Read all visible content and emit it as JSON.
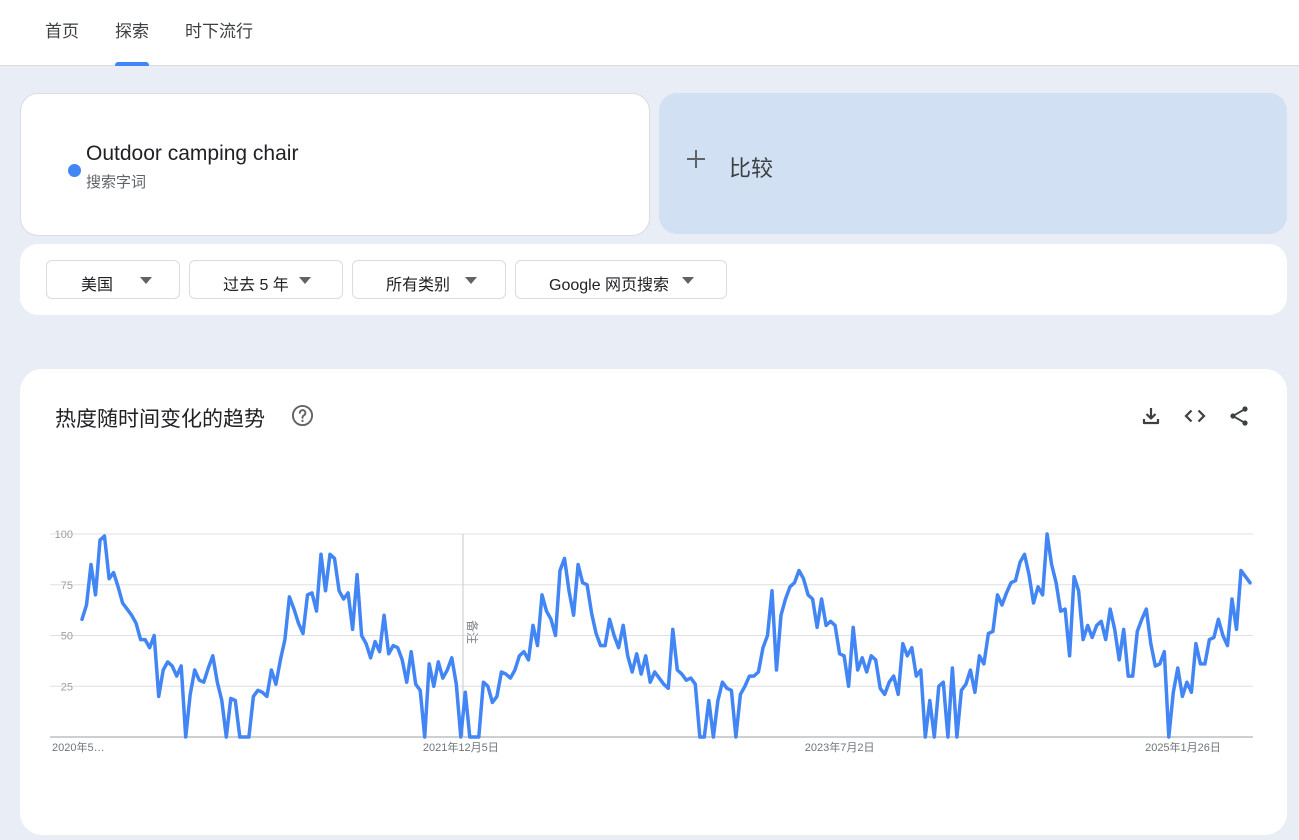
{
  "nav": {
    "tabs": [
      {
        "label": "首页"
      },
      {
        "label": "探索"
      },
      {
        "label": "时下流行"
      }
    ],
    "active_tab": "探索"
  },
  "search_term": {
    "name": "Outdoor camping chair",
    "type": "搜索字词",
    "color": "#4285f4"
  },
  "compare": {
    "label": "比较",
    "icon": "plus-icon"
  },
  "filters": {
    "region": "美国",
    "time_range": "过去 5 年",
    "category": "所有类别",
    "search_type": "Google 网页搜索"
  },
  "trend": {
    "title": "热度随时间变化的趋势",
    "help_icon": "help-circle-icon",
    "actions": [
      "download-icon",
      "embed-code-icon",
      "share-icon"
    ]
  },
  "chart_data": {
    "type": "line",
    "title": "",
    "xlabel": "",
    "ylabel": "",
    "ylim": [
      0,
      100
    ],
    "yticks": [
      25,
      50,
      75,
      100
    ],
    "grid": true,
    "line_color": "#4285f4",
    "x_tick_labels": [
      "2020年5…",
      "2021年12月5日",
      "2023年7月2日",
      "2025年1月26日"
    ],
    "x_tick_positions": [
      0,
      84,
      168,
      252
    ],
    "annotation": {
      "label": "备注",
      "index": 96
    },
    "series": [
      {
        "values": [
          58,
          65,
          85,
          70,
          97,
          99,
          78,
          81,
          74,
          66,
          63,
          60,
          56,
          48,
          48,
          44,
          50,
          20,
          33,
          37,
          35,
          30,
          35,
          0,
          21,
          33,
          28,
          27,
          34,
          40,
          27,
          18,
          0,
          19,
          18,
          0,
          0,
          0,
          20,
          23,
          22,
          20,
          33,
          26,
          38,
          48,
          69,
          63,
          56,
          51,
          70,
          71,
          62,
          90,
          72,
          90,
          88,
          72,
          68,
          71,
          53,
          80,
          50,
          46,
          39,
          47,
          42,
          60,
          41,
          45,
          44,
          38,
          27,
          42,
          26,
          23,
          0,
          36,
          25,
          37,
          29,
          33,
          39,
          26,
          0,
          22,
          0,
          0,
          0,
          27,
          25,
          17,
          20,
          32,
          31,
          29,
          33,
          40,
          42,
          38,
          55,
          45,
          70,
          62,
          58,
          50,
          82,
          88,
          72,
          60,
          85,
          76,
          75,
          61,
          51,
          45,
          45,
          58,
          50,
          44,
          55,
          40,
          32,
          41,
          31,
          40,
          27,
          32,
          29,
          26,
          24,
          53,
          33,
          31,
          28,
          29,
          26,
          0,
          0,
          18,
          0,
          18,
          27,
          24,
          23,
          0,
          21,
          25,
          30,
          30,
          32,
          44,
          50,
          72,
          33,
          60,
          68,
          74,
          76,
          82,
          78,
          70,
          68,
          54,
          68,
          55,
          57,
          55,
          41,
          40,
          25,
          54,
          33,
          39,
          32,
          40,
          38,
          24,
          21,
          27,
          30,
          21,
          46,
          40,
          44,
          30,
          33,
          0,
          18,
          0,
          25,
          27,
          0,
          34,
          0,
          23,
          26,
          33,
          22,
          40,
          36,
          51,
          52,
          70,
          65,
          71,
          76,
          77,
          86,
          90,
          80,
          66,
          74,
          70,
          100,
          85,
          76,
          62,
          63,
          40,
          79,
          72,
          48,
          55,
          49,
          55,
          57,
          48,
          63,
          53,
          38,
          53,
          30,
          30,
          52,
          58,
          63,
          46,
          35,
          36,
          42,
          0,
          22,
          34,
          20,
          27,
          22,
          46,
          36,
          36,
          48,
          49,
          58,
          50,
          45,
          68,
          53,
          82,
          79,
          76
        ]
      }
    ]
  }
}
